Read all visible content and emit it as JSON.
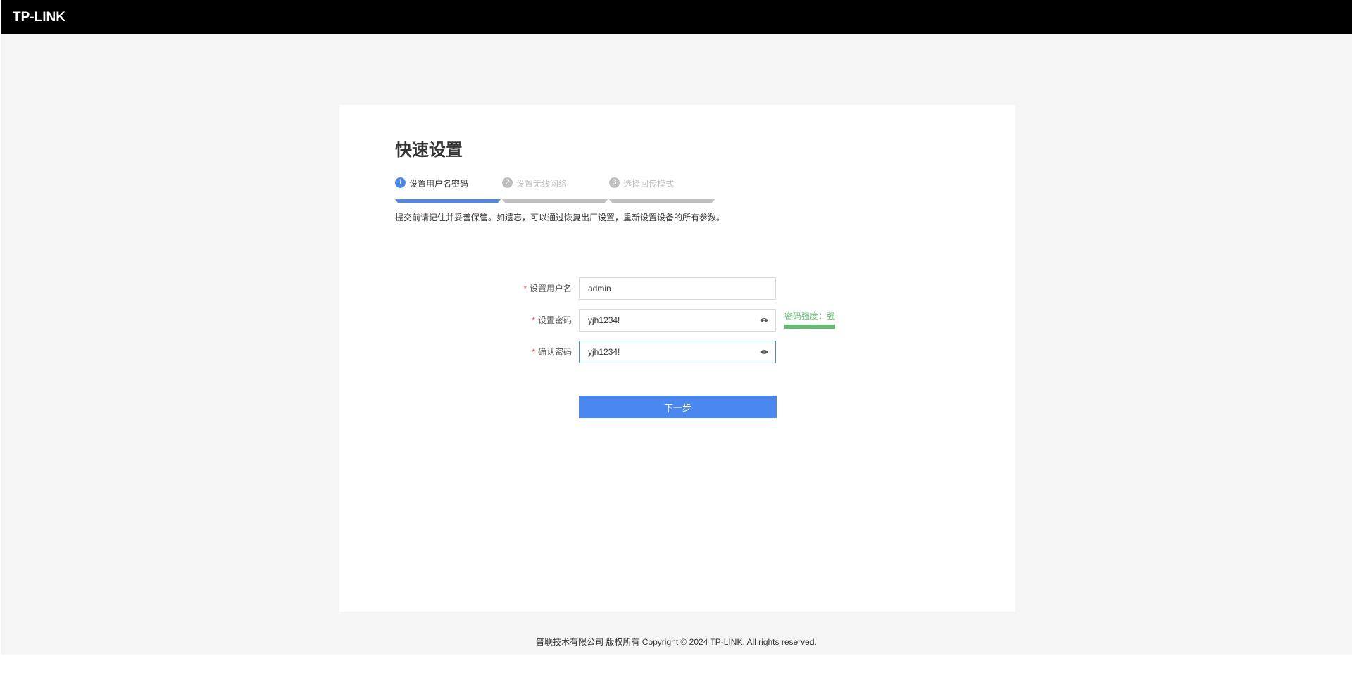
{
  "header": {
    "logo_text": "TP-LINK"
  },
  "setup": {
    "title": "快速设置",
    "steps": [
      {
        "number": "1",
        "label": "设置用户名密码",
        "active": true
      },
      {
        "number": "2",
        "label": "设置无线网络",
        "active": false
      },
      {
        "number": "3",
        "label": "选择回传模式",
        "active": false
      }
    ],
    "notice": "提交前请记住并妥善保管。如遗忘，可以通过恢复出厂设置，重新设置设备的所有参数。",
    "required_mark": "*",
    "fields": {
      "username": {
        "label": "设置用户名",
        "value": "admin"
      },
      "password": {
        "label": "设置密码",
        "value": "yjh1234!"
      },
      "confirm": {
        "label": "确认密码",
        "value": "yjh1234!"
      }
    },
    "strength_text": "密码强度：强",
    "next_label": "下一步"
  },
  "footer": {
    "copyright": "普联技术有限公司 版权所有 Copyright © 2024 TP-LINK. All rights reserved."
  },
  "colors": {
    "accent": "#4a87ee",
    "strength_strong": "#5fbf6b",
    "required": "#f04b4b",
    "topbar": "#000000"
  }
}
